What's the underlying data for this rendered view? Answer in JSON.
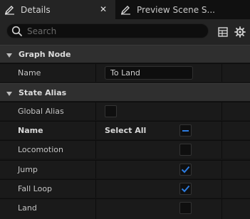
{
  "tabs": [
    {
      "label": "Details",
      "active": true,
      "close": "✕"
    },
    {
      "label": "Preview Scene S...",
      "active": false
    }
  ],
  "search": {
    "placeholder": "Search"
  },
  "icons": {
    "tab_details": "pencil-icon",
    "tab_preview": "pencil-icon",
    "search": "search-icon",
    "table_view": "table-icon",
    "settings": "gear-icon",
    "section_caret": "caret-down-icon"
  },
  "sections": {
    "graph_node": {
      "title": "Graph Node",
      "name_label": "Name",
      "name_value": "To Land"
    },
    "state_alias": {
      "title": "State Alias",
      "global_alias_label": "Global Alias",
      "global_alias_checked": false,
      "header_name": "Name",
      "header_select_all": "Select All",
      "select_all_state": "indeterminate",
      "states": [
        {
          "label": "Locomotion",
          "checked": false
        },
        {
          "label": "Jump",
          "checked": true
        },
        {
          "label": "Fall Loop",
          "checked": true
        },
        {
          "label": "Land",
          "checked": false
        }
      ]
    }
  },
  "colors": {
    "accent": "#2d7ce0",
    "panel_bg": "#1a1a1a",
    "section_bg": "#2f2f2f",
    "tab_active_bg": "#242424"
  }
}
